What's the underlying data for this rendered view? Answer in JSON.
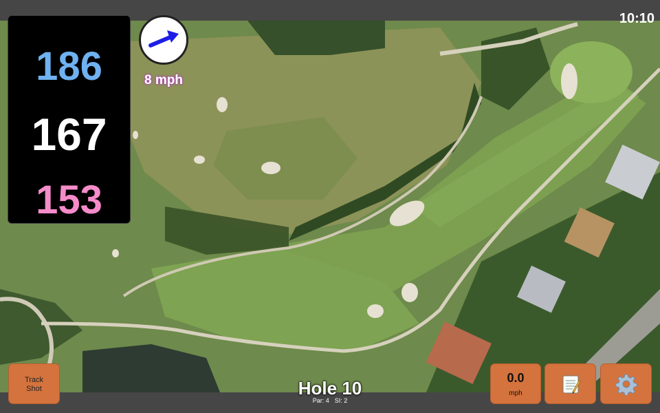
{
  "status": {
    "time": "10:10"
  },
  "distances": {
    "back": "186",
    "center": "167",
    "front": "153"
  },
  "wind": {
    "speed_label": "8 mph"
  },
  "hole": {
    "title": "Hole 10",
    "par": "Par: 4",
    "si": "SI: 2"
  },
  "buttons": {
    "track_shot": "Track\nShot",
    "speed_value": "0.0",
    "speed_unit": "mph"
  },
  "icons": {
    "wind": "wind-direction-arrow-icon",
    "notes": "notepad-icon",
    "settings": "gear-icon"
  },
  "colors": {
    "back": "#6fb1f1",
    "center": "#ffffff",
    "front": "#f58cc9",
    "button": "#d4733d",
    "wind_text_outline": "#b04db0"
  }
}
